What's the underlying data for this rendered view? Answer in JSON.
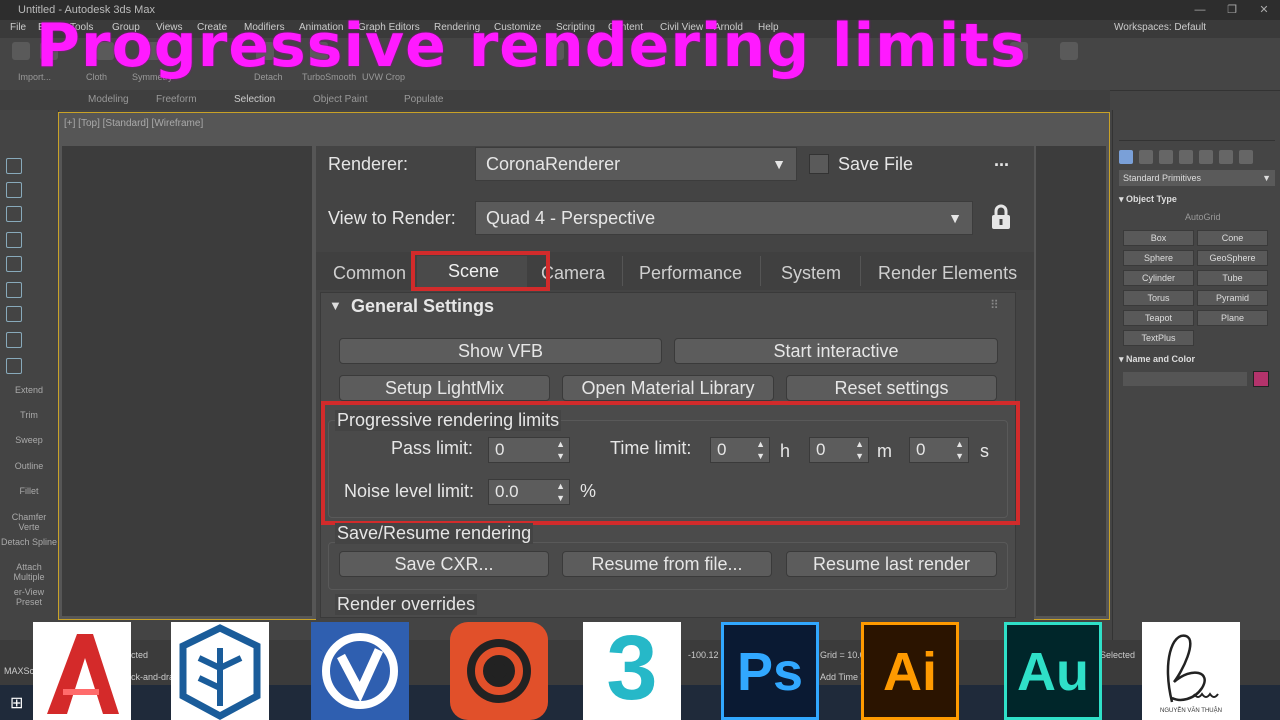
{
  "window": {
    "title": "Untitled - Autodesk 3ds Max",
    "workspace": "Workspaces: Default"
  },
  "menu": [
    "File",
    "Edit",
    "Tools",
    "Group",
    "Views",
    "Create",
    "Modifiers",
    "Animation",
    "Graph Editors",
    "Rendering",
    "Customize",
    "Scripting",
    "Content",
    "Civil View",
    "Arnold",
    "Help"
  ],
  "toolbar_labels": [
    "Import...",
    "Cloth",
    "Symmetry",
    "Detach",
    "TurboSmooth",
    "UVW Crop"
  ],
  "ribbon_tabs": [
    "Modeling",
    "Freeform",
    "Selection",
    "Object Paint",
    "Populate"
  ],
  "viewport_label": "[+] [Top] [Standard] [Wireframe]",
  "left_tools": [
    "Extend",
    "Trim",
    "Sweep",
    "Outline",
    "Fillet",
    "Chamfer Verte",
    "Detach Spline",
    "Attach Multiple",
    "er-View Preset"
  ],
  "headline": "Progressive rendering limits",
  "dialog": {
    "renderer_label": "Renderer:",
    "renderer_value": "CoronaRenderer",
    "save_file_label": "Save File",
    "more": "...",
    "view_label": "View to Render:",
    "view_value": "Quad 4 - Perspective",
    "tabs": [
      "Common",
      "Scene",
      "Camera",
      "Performance",
      "System",
      "Render Elements"
    ],
    "section_title": "General Settings",
    "buttons": {
      "show_vfb": "Show VFB",
      "start_interactive": "Start interactive",
      "setup_lightmix": "Setup LightMix",
      "open_material_library": "Open Material Library",
      "reset_settings": "Reset settings"
    },
    "progressive": {
      "title": "Progressive rendering limits",
      "pass_label": "Pass limit:",
      "pass_value": "0",
      "time_label": "Time limit:",
      "hours": "0",
      "h": "h",
      "minutes": "0",
      "m": "m",
      "seconds": "0",
      "s": "s",
      "noise_label": "Noise level limit:",
      "noise_value": "0.0",
      "pct": "%"
    },
    "save_resume": {
      "title": "Save/Resume rendering",
      "save_cxr": "Save CXR...",
      "resume_file": "Resume from file...",
      "resume_last": "Resume last render"
    },
    "render_overrides": "Render overrides"
  },
  "right_panel": {
    "dropdown": "Standard Primitives",
    "object_type": "Object Type",
    "autogrid": "AutoGrid",
    "objects": [
      "Box",
      "Cone",
      "Sphere",
      "GeoSphere",
      "Cylinder",
      "Tube",
      "Torus",
      "Pyramid",
      "Teapot",
      "Plane",
      "TextPlus"
    ],
    "name_color": "Name and Color",
    "swatch_color": "#b3336b"
  },
  "status": {
    "left_text": "MAXScr",
    "selected": "cted",
    "hint": "ck-and-dra",
    "coord": "-100.12",
    "grid": "Grid = 10.0m",
    "add_time": "Add Time T",
    "selected2": "Selected"
  },
  "apps": [
    {
      "name": "AutoCAD",
      "text": "A",
      "bg": "#ffffff",
      "fg": "#d42a2a"
    },
    {
      "name": "SketchUp",
      "text": "S",
      "bg": "#ffffff",
      "fg": "#1a5c9a"
    },
    {
      "name": "V-Ray",
      "text": "V",
      "bg": "#2f5fb0",
      "fg": "#ffffff"
    },
    {
      "name": "Corona",
      "text": "",
      "bg": "#e1502a",
      "fg": "#ffffff"
    },
    {
      "name": "3ds Max",
      "text": "3",
      "bg": "#ffffff",
      "fg": "#26b8c8"
    },
    {
      "name": "Photoshop",
      "text": "Ps",
      "bg": "#0a1a33",
      "fg": "#31a8ff"
    },
    {
      "name": "Illustrator",
      "text": "Ai",
      "bg": "#2b1400",
      "fg": "#ff9a00"
    },
    {
      "name": "Audition",
      "text": "Au",
      "bg": "#00262a",
      "fg": "#2fe0c8"
    },
    {
      "name": "Bunny signature",
      "text": "",
      "bg": "#ffffff",
      "fg": "#222222"
    }
  ],
  "signature_caption": "NGUYỄN VĂN THUẬN"
}
